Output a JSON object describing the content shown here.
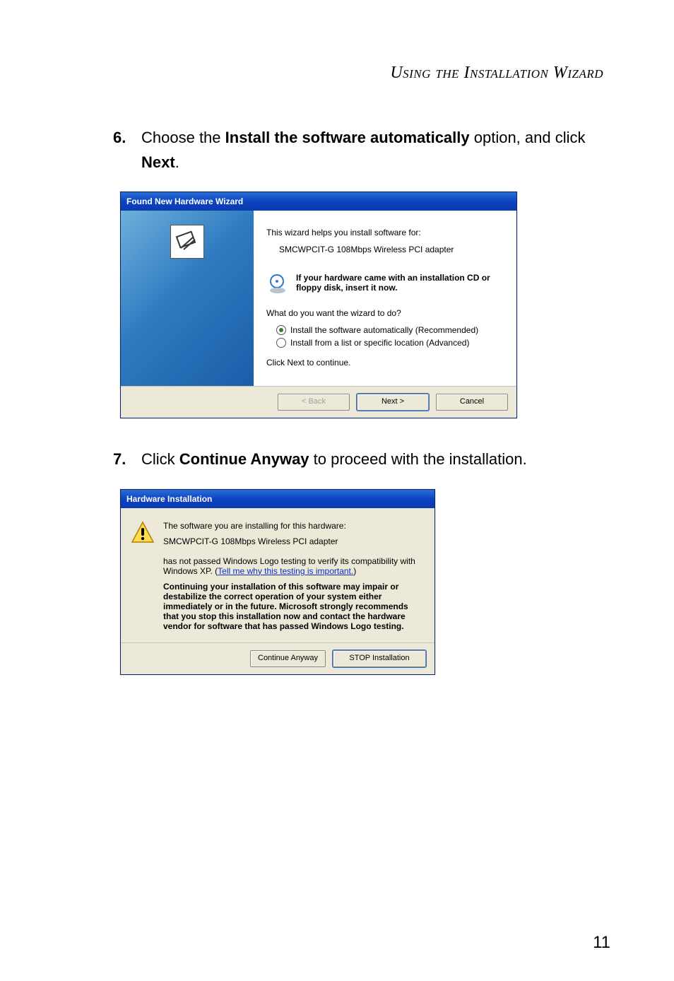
{
  "page": {
    "section_header": "Using the Installation Wizard",
    "page_number": "11"
  },
  "step6": {
    "number": "6.",
    "pre": "Choose the ",
    "bold1": "Install the software automatically",
    "mid": " option, and click ",
    "bold2": "Next",
    "post": "."
  },
  "step7": {
    "number": "7.",
    "pre": "Click ",
    "bold1": "Continue Anyway",
    "post": " to proceed with the installation."
  },
  "dialog1": {
    "title": "Found New Hardware Wizard",
    "intro": "This wizard helps you install software for:",
    "device": "SMCWPCIT-G 108Mbps Wireless PCI adapter",
    "cd_note": "If your hardware came with an installation CD or floppy disk, insert it now.",
    "prompt": "What do you want the wizard to do?",
    "radio1": "Install the software automatically (Recommended)",
    "radio2": "Install from a list or specific location (Advanced)",
    "continue": "Click Next to continue.",
    "btn_back": "< Back",
    "btn_next": "Next >",
    "btn_cancel": "Cancel"
  },
  "dialog2": {
    "title": "Hardware Installation",
    "line1": "The software you are installing for this hardware:",
    "device": "SMCWPCIT-G 108Mbps Wireless PCI adapter",
    "line2a": "has not passed Windows Logo testing to verify its compatibility with Windows XP. (",
    "link": "Tell me why this testing is important.",
    "line2b": ")",
    "bold_block": "Continuing your installation of this software may impair or destabilize the correct operation of your system either immediately or in the future. Microsoft strongly recommends that you stop this installation now and contact the hardware vendor for software that has passed Windows Logo testing.",
    "btn_continue": "Continue Anyway",
    "btn_stop": "STOP Installation"
  }
}
